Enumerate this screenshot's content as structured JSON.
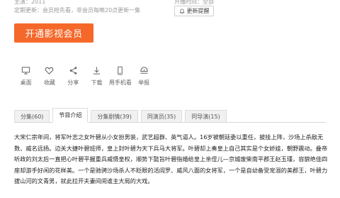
{
  "meta": {
    "top_left_text": "主演：2011",
    "top_right_text": "开播时间：全部"
  },
  "schedule_text": "定期更新：会员抢先看，非会员每晚20点更新一集",
  "remind_button": {
    "label": "更新提醒",
    "icon": "bell-icon"
  },
  "vip_button": {
    "label": "开通影视会员"
  },
  "actions": [
    {
      "label": "桌面",
      "icon": "monitor-icon"
    },
    {
      "label": "收藏",
      "icon": "heart-icon"
    },
    {
      "label": "分享",
      "icon": "share-icon"
    },
    {
      "label": "下载",
      "icon": "download-icon"
    },
    {
      "label": "用手机看",
      "icon": "phone-icon"
    },
    {
      "label": "举报",
      "icon": "report-icon"
    }
  ],
  "tabs": [
    {
      "label": "分集(60)",
      "active": false
    },
    {
      "label": "节目介绍",
      "active": true
    },
    {
      "label": "分集剧情(39)",
      "active": false
    },
    {
      "label": "同演员(35)",
      "active": false
    },
    {
      "label": "同导演(15)",
      "active": false
    }
  ],
  "description": "大宋仁宗年间，将军叶志之女叶碧从小女扮男装，武艺超群、英气逼人。16岁被朝廷委以重任，披挂上阵，沙场上杀敌无数、威名远扬。边关大捷叶碧班师，皇上封叶碧为天下兵马大将军。叶碧却上奏皇上自己其实是个女娇娃，朝野震动。叠帝听政的刘太后一直把心叶碧平握重兵威慑皇权，顺势下懿旨叶碧指婚给皇上亲侄儿—京城废柴南平郡王赵玉瑾，容貌绝佳四座却游手好闲的花样美。一个是驰骋沙场杀人不眨眼的活阎罗、威风八面的女将军，一个是自幼备受宠溺的美郡王，叶碧力拔山河的文青男，就此拉开夫妻间闹谁主大局的大戏。"
}
